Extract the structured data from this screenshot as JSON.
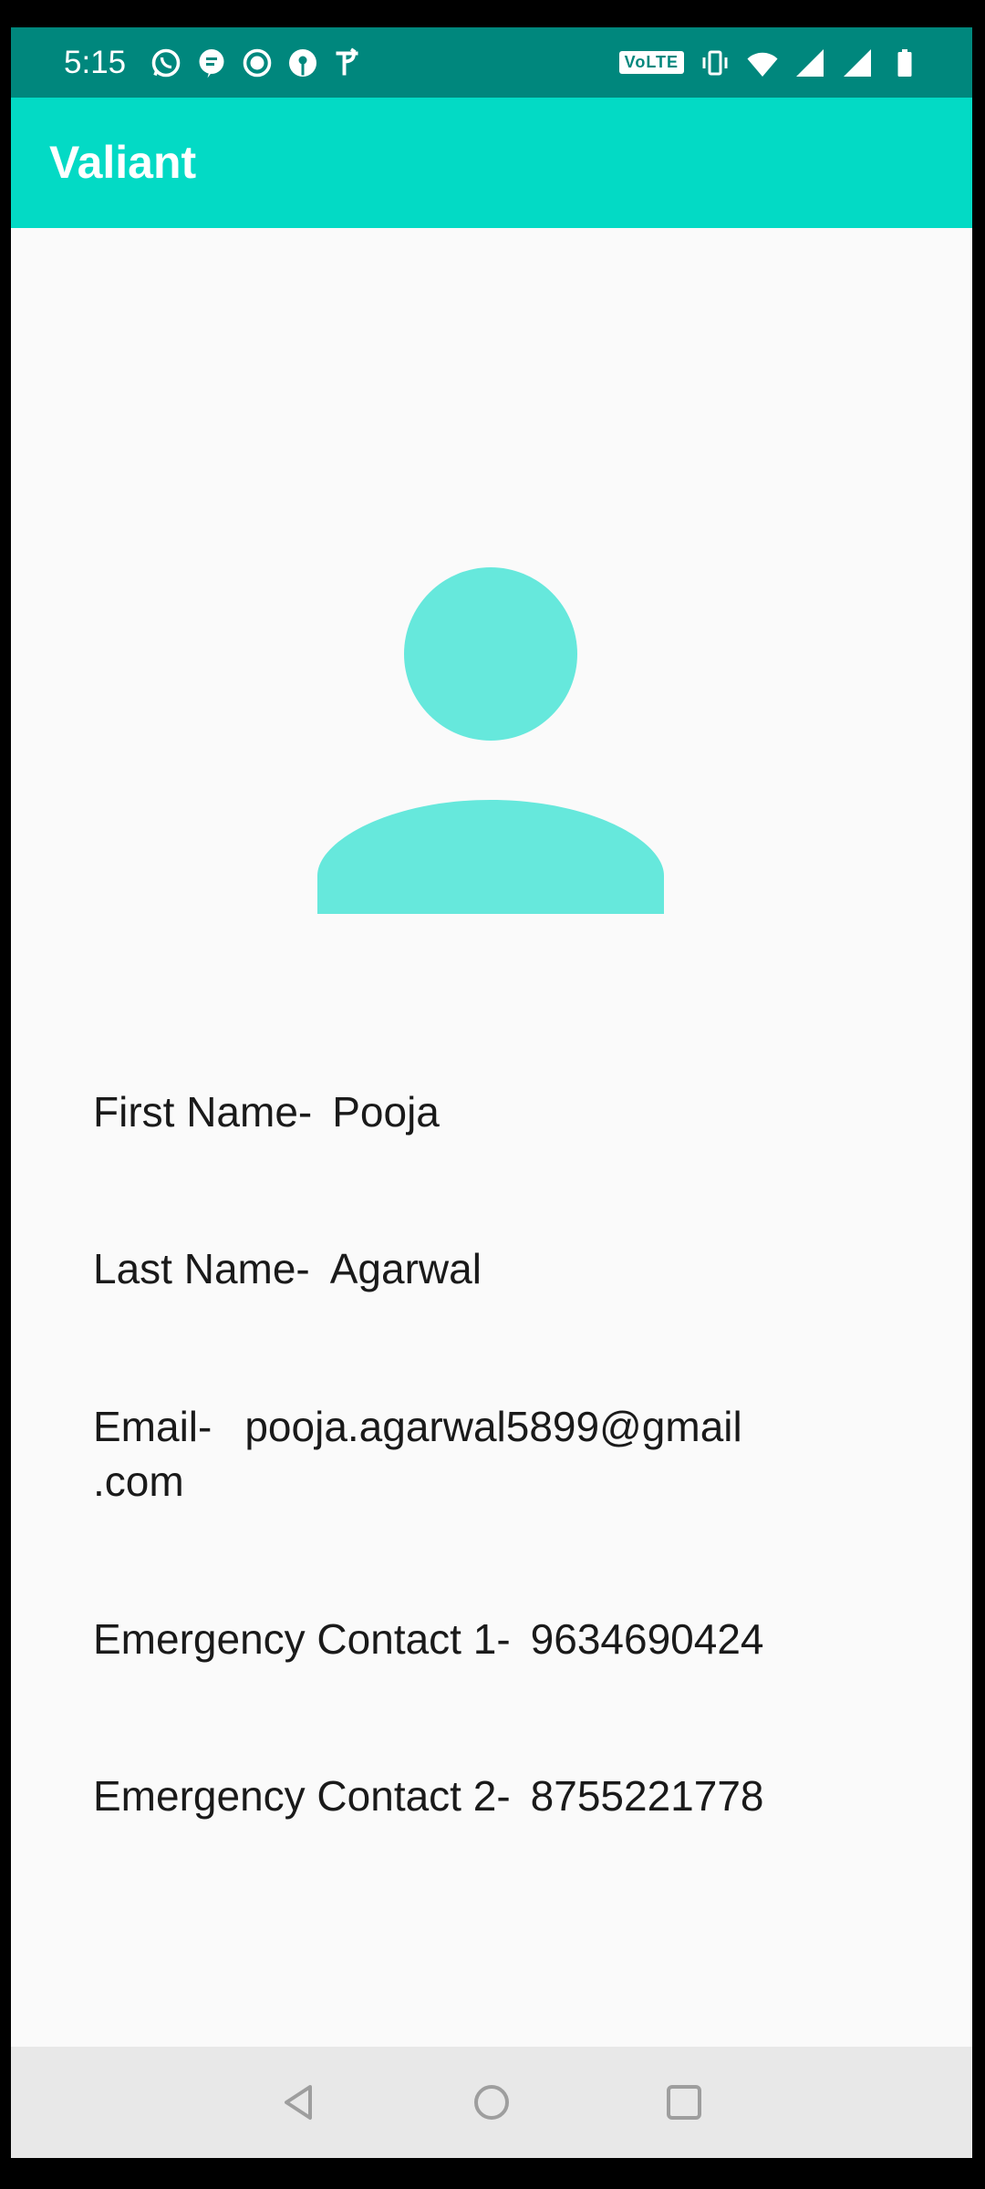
{
  "status_bar": {
    "time": "5:15",
    "left_icons": [
      "whatsapp-icon",
      "message-icon",
      "record-icon",
      "bank-icon",
      "phonepe-icon"
    ],
    "volte": "VoLTE",
    "right_icons": [
      "vibrate-icon",
      "wifi-icon",
      "signal-icon",
      "signal-icon",
      "battery-icon"
    ]
  },
  "app_bar": {
    "title": "Valiant"
  },
  "profile": {
    "avatar_color": "#66e8dc",
    "first_name_label": "First Name-",
    "first_name": "Pooja",
    "last_name_label": "Last Name-",
    "last_name": "Agarwal",
    "email_label": "Email-",
    "email_line1": "pooja.agarwal5899@gmail",
    "email_line2": ".com",
    "contact1_label": "Emergency Contact 1-",
    "contact1": "9634690424",
    "contact2_label": "Emergency Contact 2-",
    "contact2": "8755221778"
  },
  "nav_bar": {
    "buttons": [
      "back-icon",
      "home-icon",
      "recents-icon"
    ]
  },
  "colors": {
    "status_bar": "#00877d",
    "app_bar": "#03dac5",
    "background": "#fafafa"
  }
}
